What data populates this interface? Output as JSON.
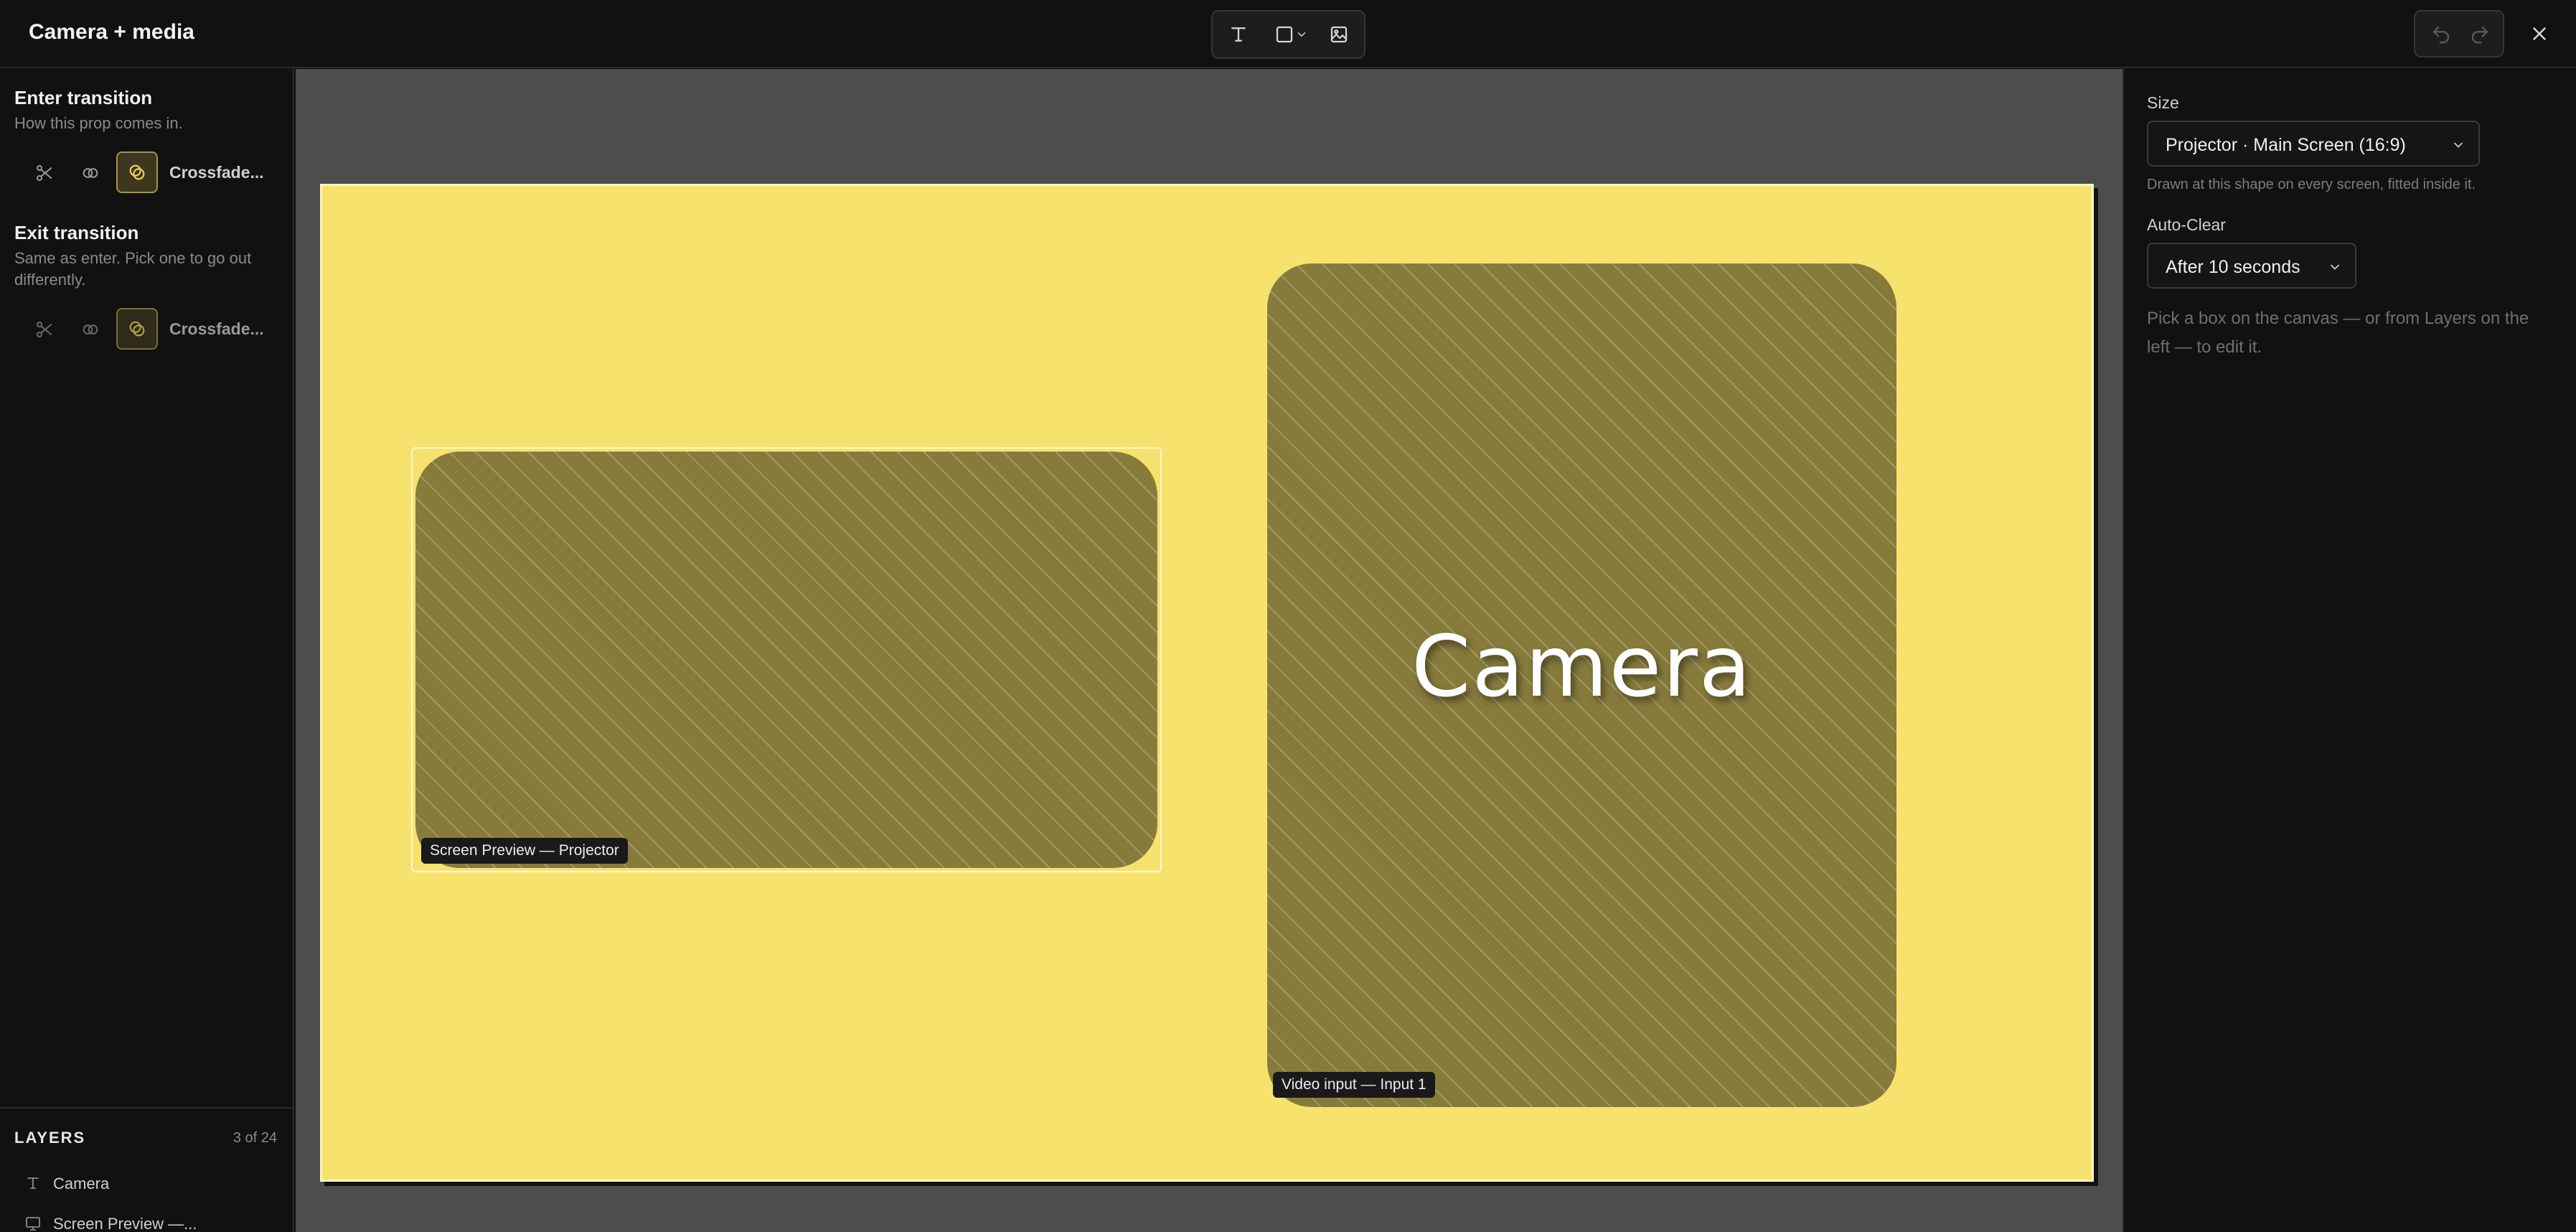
{
  "header": {
    "title": "Camera + media"
  },
  "toolbar": {
    "icons": [
      "text-tool-icon",
      "shape-tool-icon",
      "chevron-down-icon",
      "image-tool-icon"
    ]
  },
  "history": {
    "icons": [
      "undo-icon",
      "redo-icon"
    ]
  },
  "enter_transition": {
    "title": "Enter transition",
    "description": "How this prop comes in.",
    "selected_label": "Crossfade..."
  },
  "exit_transition": {
    "title": "Exit transition",
    "description": "Same as enter. Pick one to go out differently.",
    "selected_label": "Crossfade..."
  },
  "layers": {
    "title": "LAYERS",
    "count": "3 of 24",
    "items": [
      {
        "label": "Camera",
        "icon": "text-layer-icon"
      },
      {
        "label": "Screen Preview —...",
        "icon": "screen-layer-icon"
      }
    ]
  },
  "canvas": {
    "slide_color": "#f7e26e",
    "screen_preview_label": "Screen Preview — Projector",
    "video_input_label": "Video input — Input 1",
    "camera_text": "Camera"
  },
  "properties": {
    "size_label": "Size",
    "size_value": "Projector · Main Screen (16:9)",
    "size_hint": "Drawn at this shape on every screen, fitted inside it.",
    "auto_clear_label": "Auto-Clear",
    "auto_clear_value": "After 10 seconds",
    "empty_note": "Pick a box on the canvas — or from Layers on the left — to edit it."
  },
  "colors": {
    "accent": "#a89343",
    "panel": "#111111",
    "canvas_bg": "#4d4d4d"
  }
}
